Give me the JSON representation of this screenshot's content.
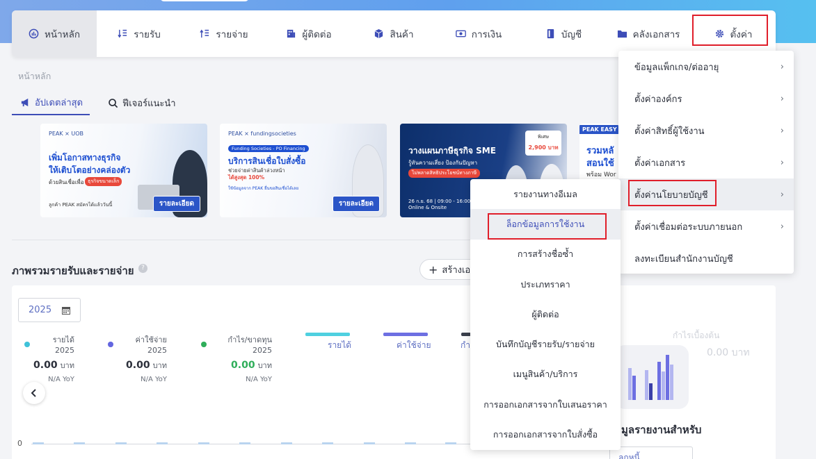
{
  "nav": {
    "items": [
      {
        "label": "หน้าหลัก",
        "icon": "dashboard-icon"
      },
      {
        "label": "รายรับ",
        "icon": "income-icon"
      },
      {
        "label": "รายจ่าย",
        "icon": "expense-icon"
      },
      {
        "label": "ผู้ติดต่อ",
        "icon": "contacts-icon"
      },
      {
        "label": "สินค้า",
        "icon": "box-icon"
      },
      {
        "label": "การเงิน",
        "icon": "money-icon"
      },
      {
        "label": "บัญชี",
        "icon": "ledger-icon"
      },
      {
        "label": "คลังเอกสาร",
        "icon": "folder-icon"
      },
      {
        "label": "ตั้งค่า",
        "icon": "gear-icon"
      }
    ]
  },
  "breadcrumb": "หน้าหลัก",
  "tabs": [
    {
      "label": "อัปเดตล่าสุด",
      "icon": "megaphone-icon"
    },
    {
      "label": "ฟีเจอร์แนะนำ",
      "icon": "search-icon"
    }
  ],
  "banners": {
    "b1": {
      "logo": "PEAK × UOB",
      "line1": "เพิ่มโอกาสทางธุรกิจ",
      "line2": "ให้เติบโตอย่างคล่องตัว",
      "line3": "ด้วยสินเชื่อเพื่อ",
      "tag": "ธุรกิจขนาดเล็ก",
      "line4": "ลูกค้า PEAK สมัครได้แล้ววันนี้",
      "button": "รายละเอียด"
    },
    "b2": {
      "logo": "PEAK × fundingsocieties",
      "badge": "Funding Societies - PO Financing",
      "title": "บริการสินเชื่อใบสั่งซื้อ",
      "sub": "ช่วยจ่ายค่าสินค้าล่วงหน้า",
      "sub2": "ได้สูงสุด 100%",
      "small": "ใช้ข้อมูลจาก PEAK ยื่นขอสินเชื่อได้เลย",
      "button": "รายละเอียด"
    },
    "b3": {
      "title": "วางแผนภาษีธุรกิจ SME",
      "sub": "รู้ทันความเสี่ยง ป้องกันปัญหา",
      "tag": "ไม่พลาดสิทธิประโยชน์ทางภาษี",
      "price_label": "พิเศษ",
      "price": "2,900 บาท",
      "date": "26 ก.ย. 68 | 09:00 - 16:00",
      "mode": "Online & Onsite"
    },
    "b4": {
      "tag": "PEAK EASY",
      "t1": "รวมหลั",
      "t2": "สอนใช้",
      "t3": "พร้อม Wor"
    }
  },
  "section": {
    "title": "ภาพรวมรายรับและรายจ่าย",
    "help": "?",
    "create_label": "สร้างเอ",
    "year": "2025"
  },
  "stats": [
    {
      "label": "รายได้ 2025",
      "value": "0.00",
      "unit": "บาท",
      "yoy": "N/A YoY",
      "color": "#3fc2d9"
    },
    {
      "label": "ค่าใช้จ่าย 2025",
      "value": "0.00",
      "unit": "บาท",
      "yoy": "N/A YoY",
      "color": "#6366e0"
    },
    {
      "label": "กำไร/ขาดทุน 2025",
      "value": "0.00",
      "unit": "บาท",
      "yoy": "N/A YoY",
      "color": "#2fae5a"
    }
  ],
  "legend": [
    {
      "label": "รายได้",
      "color": "#4fd0e0"
    },
    {
      "label": "ค่าใช้จ่าย",
      "color": "#6d6fe2"
    },
    {
      "label": "กำ",
      "color": "#3a3f4b"
    }
  ],
  "chart": {
    "zero_label": "0"
  },
  "right_card": {
    "ghost1": "กำไรเบื้องต้น",
    "ghost2": "0.00 บาท",
    "title": "อมูลรายงานสำหรับ",
    "input": "ลูกหนี้"
  },
  "settings_menu": [
    {
      "label": "ข้อมูลแพ็กเกจ/ต่ออายุ"
    },
    {
      "label": "ตั้งค่าองค์กร"
    },
    {
      "label": "ตั้งค่าสิทธิ์ผู้ใช้งาน"
    },
    {
      "label": "ตั้งค่าเอกสาร"
    },
    {
      "label": "ตั้งค่านโยบายบัญชี"
    },
    {
      "label": "ตั้งค่าเชื่อมต่อระบบภายนอก"
    },
    {
      "label": "ลงทะเบียนสำนักงานบัญชี"
    }
  ],
  "policy_submenu": [
    "รายงานทางอีเมล",
    "ล็อกข้อมูลการใช้งาน",
    "การสร้างชื่อซ้ำ",
    "ประเภทราคา",
    "ผู้ติดต่อ",
    "บันทึกบัญชีรายรับ/รายจ่าย",
    "เมนูสินค้า/บริการ",
    "การออกเอกสารจากใบเสนอราคา",
    "การออกเอกสารจากใบสั่งซื้อ"
  ],
  "colors": {
    "accent": "#3d4db7",
    "highlight": "#e01e2a"
  }
}
